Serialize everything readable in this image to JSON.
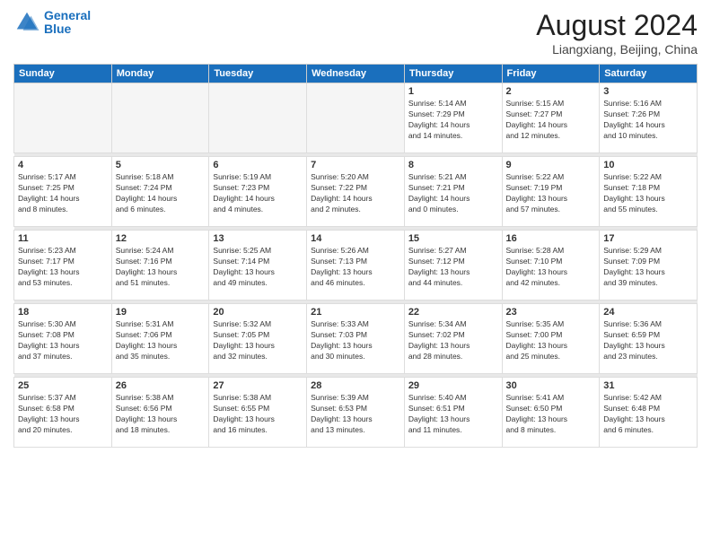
{
  "header": {
    "logo_line1": "General",
    "logo_line2": "Blue",
    "title": "August 2024",
    "subtitle": "Liangxiang, Beijing, China"
  },
  "weekdays": [
    "Sunday",
    "Monday",
    "Tuesday",
    "Wednesday",
    "Thursday",
    "Friday",
    "Saturday"
  ],
  "weeks": [
    [
      {
        "day": "",
        "info": ""
      },
      {
        "day": "",
        "info": ""
      },
      {
        "day": "",
        "info": ""
      },
      {
        "day": "",
        "info": ""
      },
      {
        "day": "1",
        "info": "Sunrise: 5:14 AM\nSunset: 7:29 PM\nDaylight: 14 hours\nand 14 minutes."
      },
      {
        "day": "2",
        "info": "Sunrise: 5:15 AM\nSunset: 7:27 PM\nDaylight: 14 hours\nand 12 minutes."
      },
      {
        "day": "3",
        "info": "Sunrise: 5:16 AM\nSunset: 7:26 PM\nDaylight: 14 hours\nand 10 minutes."
      }
    ],
    [
      {
        "day": "4",
        "info": "Sunrise: 5:17 AM\nSunset: 7:25 PM\nDaylight: 14 hours\nand 8 minutes."
      },
      {
        "day": "5",
        "info": "Sunrise: 5:18 AM\nSunset: 7:24 PM\nDaylight: 14 hours\nand 6 minutes."
      },
      {
        "day": "6",
        "info": "Sunrise: 5:19 AM\nSunset: 7:23 PM\nDaylight: 14 hours\nand 4 minutes."
      },
      {
        "day": "7",
        "info": "Sunrise: 5:20 AM\nSunset: 7:22 PM\nDaylight: 14 hours\nand 2 minutes."
      },
      {
        "day": "8",
        "info": "Sunrise: 5:21 AM\nSunset: 7:21 PM\nDaylight: 14 hours\nand 0 minutes."
      },
      {
        "day": "9",
        "info": "Sunrise: 5:22 AM\nSunset: 7:19 PM\nDaylight: 13 hours\nand 57 minutes."
      },
      {
        "day": "10",
        "info": "Sunrise: 5:22 AM\nSunset: 7:18 PM\nDaylight: 13 hours\nand 55 minutes."
      }
    ],
    [
      {
        "day": "11",
        "info": "Sunrise: 5:23 AM\nSunset: 7:17 PM\nDaylight: 13 hours\nand 53 minutes."
      },
      {
        "day": "12",
        "info": "Sunrise: 5:24 AM\nSunset: 7:16 PM\nDaylight: 13 hours\nand 51 minutes."
      },
      {
        "day": "13",
        "info": "Sunrise: 5:25 AM\nSunset: 7:14 PM\nDaylight: 13 hours\nand 49 minutes."
      },
      {
        "day": "14",
        "info": "Sunrise: 5:26 AM\nSunset: 7:13 PM\nDaylight: 13 hours\nand 46 minutes."
      },
      {
        "day": "15",
        "info": "Sunrise: 5:27 AM\nSunset: 7:12 PM\nDaylight: 13 hours\nand 44 minutes."
      },
      {
        "day": "16",
        "info": "Sunrise: 5:28 AM\nSunset: 7:10 PM\nDaylight: 13 hours\nand 42 minutes."
      },
      {
        "day": "17",
        "info": "Sunrise: 5:29 AM\nSunset: 7:09 PM\nDaylight: 13 hours\nand 39 minutes."
      }
    ],
    [
      {
        "day": "18",
        "info": "Sunrise: 5:30 AM\nSunset: 7:08 PM\nDaylight: 13 hours\nand 37 minutes."
      },
      {
        "day": "19",
        "info": "Sunrise: 5:31 AM\nSunset: 7:06 PM\nDaylight: 13 hours\nand 35 minutes."
      },
      {
        "day": "20",
        "info": "Sunrise: 5:32 AM\nSunset: 7:05 PM\nDaylight: 13 hours\nand 32 minutes."
      },
      {
        "day": "21",
        "info": "Sunrise: 5:33 AM\nSunset: 7:03 PM\nDaylight: 13 hours\nand 30 minutes."
      },
      {
        "day": "22",
        "info": "Sunrise: 5:34 AM\nSunset: 7:02 PM\nDaylight: 13 hours\nand 28 minutes."
      },
      {
        "day": "23",
        "info": "Sunrise: 5:35 AM\nSunset: 7:00 PM\nDaylight: 13 hours\nand 25 minutes."
      },
      {
        "day": "24",
        "info": "Sunrise: 5:36 AM\nSunset: 6:59 PM\nDaylight: 13 hours\nand 23 minutes."
      }
    ],
    [
      {
        "day": "25",
        "info": "Sunrise: 5:37 AM\nSunset: 6:58 PM\nDaylight: 13 hours\nand 20 minutes."
      },
      {
        "day": "26",
        "info": "Sunrise: 5:38 AM\nSunset: 6:56 PM\nDaylight: 13 hours\nand 18 minutes."
      },
      {
        "day": "27",
        "info": "Sunrise: 5:38 AM\nSunset: 6:55 PM\nDaylight: 13 hours\nand 16 minutes."
      },
      {
        "day": "28",
        "info": "Sunrise: 5:39 AM\nSunset: 6:53 PM\nDaylight: 13 hours\nand 13 minutes."
      },
      {
        "day": "29",
        "info": "Sunrise: 5:40 AM\nSunset: 6:51 PM\nDaylight: 13 hours\nand 11 minutes."
      },
      {
        "day": "30",
        "info": "Sunrise: 5:41 AM\nSunset: 6:50 PM\nDaylight: 13 hours\nand 8 minutes."
      },
      {
        "day": "31",
        "info": "Sunrise: 5:42 AM\nSunset: 6:48 PM\nDaylight: 13 hours\nand 6 minutes."
      }
    ]
  ]
}
